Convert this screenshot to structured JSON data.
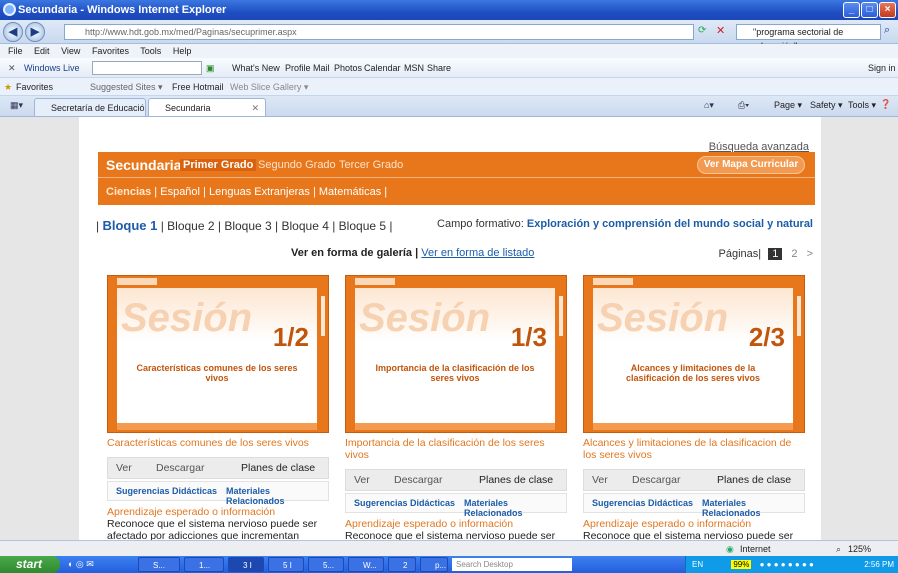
{
  "window": {
    "title": "Secundaria - Windows Internet Explorer"
  },
  "addressbar": {
    "url": "http://www.hdt.gob.mx/med/Paginas/secuprimer.aspx",
    "search_text": "\"programa sectorial de educación\""
  },
  "menu": [
    "File",
    "Edit",
    "View",
    "Favorites",
    "Tools",
    "Help"
  ],
  "windows_live": {
    "brand": "Windows Live",
    "links": [
      "What's New",
      "Profile",
      "Mail",
      "Photos",
      "Calendar",
      "MSN",
      "Share"
    ],
    "signin": "Sign in"
  },
  "favorites_bar": {
    "label": "Favorites",
    "items": [
      "Suggested Sites ▾",
      "Free Hotmail",
      "Web Slice Gallery ▾"
    ]
  },
  "tabs": [
    {
      "label": "Secretaría de Educación Públi..."
    },
    {
      "label": "Secundaria"
    }
  ],
  "command_bar": [
    "Page ▾",
    "Safety ▾",
    "Tools ▾"
  ],
  "page": {
    "advanced_search": "Búsqueda avanzada",
    "brand": "Secundaria",
    "grades": [
      "Primer Grado",
      "Segundo Grado",
      "Tercer Grado"
    ],
    "map_button": "Ver Mapa Curricular",
    "subjects": [
      "Ciencias",
      "Español",
      "Lenguas Extranjeras",
      "Matemáticas"
    ],
    "bloques": [
      "Bloque 1",
      "Bloque 2",
      "Bloque 3",
      "Bloque 4",
      "Bloque 5"
    ],
    "campo_label": "Campo formativo:",
    "campo_value": "Exploración y comprensión del mundo social y natural",
    "view_gallery": "Ver en forma de galería",
    "view_list": "Ver en forma de listado",
    "pages_label": "Páginas|",
    "pages": [
      "1",
      "2",
      ">"
    ],
    "cards": [
      {
        "slide_word": "Sesión",
        "fraction": "1/2",
        "slide_title": "Características comunes de los seres vivos",
        "title": "Características comunes de los seres vivos",
        "btn_ver": "Ver",
        "btn_descargar": "Descargar",
        "btn_planes": "Planes de clase",
        "link_sug": "Sugerencias Didácticas",
        "link_mat": "Materiales Relacionados",
        "aprendizaje": "Aprendizaje esperado o información",
        "aprendizaje_text": "Reconoce que el sistema nervioso puede ser afectado por adicciones que incrementan"
      },
      {
        "slide_word": "Sesión",
        "fraction": "1/3",
        "slide_title": "Importancia de la clasificación de los seres vivos",
        "title": "Importancia de la clasificación de los seres vivos",
        "btn_ver": "Ver",
        "btn_descargar": "Descargar",
        "btn_planes": "Planes de clase",
        "link_sug": "Sugerencias Didácticas",
        "link_mat": "Materiales Relacionados",
        "aprendizaje": "Aprendizaje esperado o información",
        "aprendizaje_text": "Reconoce que el sistema nervioso puede ser"
      },
      {
        "slide_word": "Sesión",
        "fraction": "2/3",
        "slide_title": "Alcances y limitaciones de la clasificación de los seres vivos",
        "title": "Alcances y limitaciones de la clasificacion de los seres vivos",
        "btn_ver": "Ver",
        "btn_descargar": "Descargar",
        "btn_planes": "Planes de clase",
        "link_sug": "Sugerencias Didácticas",
        "link_mat": "Materiales Relacionados",
        "aprendizaje": "Aprendizaje esperado o información",
        "aprendizaje_text": "Reconoce que el sistema nervioso puede ser"
      }
    ]
  },
  "statusbar": {
    "zone": "Internet",
    "zoom": "125%"
  },
  "taskbar": {
    "start": "start",
    "tasks": [
      "S...",
      "1...",
      "3 I",
      "5 I",
      "5...",
      "W...",
      "2",
      "p..."
    ],
    "search_placeholder": "Search Desktop",
    "lang": "EN",
    "battery": "99%",
    "time": "2:56 PM"
  }
}
